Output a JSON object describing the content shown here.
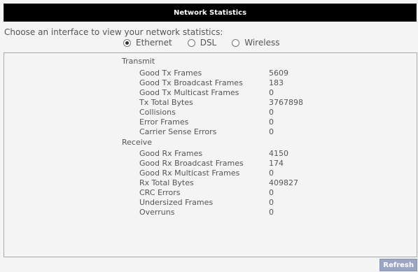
{
  "window": {
    "title": "Network Statistics"
  },
  "prompt": "Choose an interface to view your network statistics:",
  "interfaces": [
    {
      "label": "Ethernet",
      "selected": true
    },
    {
      "label": "DSL",
      "selected": false
    },
    {
      "label": "Wireless",
      "selected": false
    }
  ],
  "transmit": {
    "heading": "Transmit",
    "rows": [
      {
        "label": "Good Tx Frames",
        "value": "5609"
      },
      {
        "label": "Good Tx Broadcast Frames",
        "value": "183"
      },
      {
        "label": "Good Tx Multicast Frames",
        "value": "0"
      },
      {
        "label": "Tx Total Bytes",
        "value": "3767898"
      },
      {
        "label": "Collisions",
        "value": "0"
      },
      {
        "label": "Error Frames",
        "value": "0"
      },
      {
        "label": "Carrier Sense Errors",
        "value": "0"
      }
    ]
  },
  "receive": {
    "heading": "Receive",
    "rows": [
      {
        "label": "Good Rx Frames",
        "value": "4150"
      },
      {
        "label": "Good Rx Broadcast Frames",
        "value": "174"
      },
      {
        "label": "Good Rx Multicast Frames",
        "value": "0"
      },
      {
        "label": "Rx Total Bytes",
        "value": "409827"
      },
      {
        "label": "CRC Errors",
        "value": "0"
      },
      {
        "label": "Undersized Frames",
        "value": "0"
      },
      {
        "label": "Overruns",
        "value": "0"
      }
    ]
  },
  "actions": {
    "refresh_label": "Refresh"
  },
  "colors": {
    "titlebar_bg": "#000000",
    "refresh_bg": "#9aa6c4",
    "text": "#555555"
  }
}
